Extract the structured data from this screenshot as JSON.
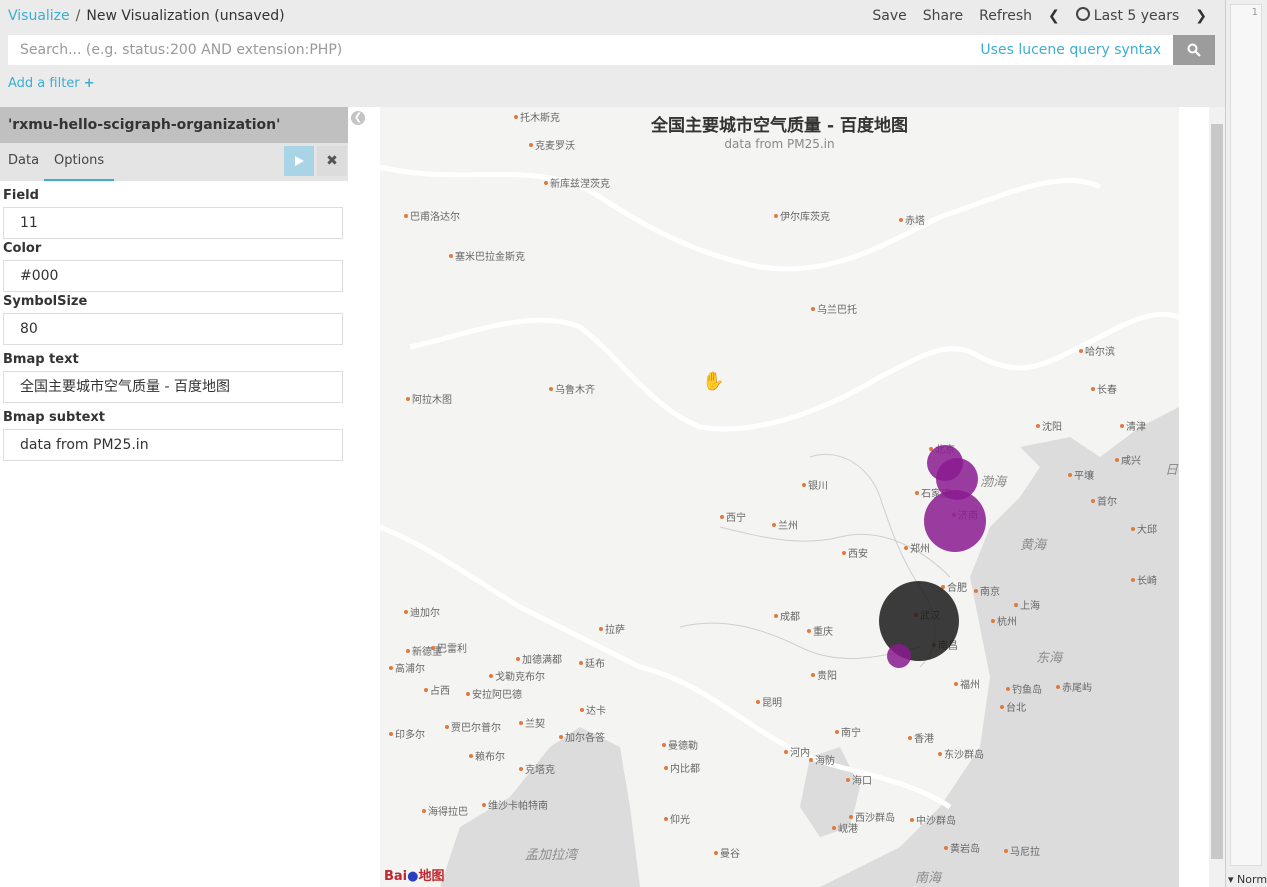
{
  "breadcrumb": {
    "root": "Visualize",
    "separator": "/",
    "current": "New Visualization (unsaved)"
  },
  "menu": {
    "save": "Save",
    "share": "Share",
    "refresh": "Refresh",
    "time_range": "Last 5 years"
  },
  "search": {
    "placeholder": "Search... (e.g. status:200 AND extension:PHP)",
    "syntax_link": "Uses lucene query syntax"
  },
  "filter": {
    "add_label": "Add a filter"
  },
  "sidebar": {
    "index_name": "'rxmu-hello-scigraph-organization'",
    "tabs": [
      {
        "label": "Data"
      },
      {
        "label": "Options"
      }
    ],
    "fields": [
      {
        "label": "Field",
        "value": "11"
      },
      {
        "label": "Color",
        "value": "#000"
      },
      {
        "label": "SymbolSize",
        "value": "80"
      },
      {
        "label": "Bmap text",
        "value": "全国主要城市空气质量 - 百度地图"
      },
      {
        "label": "Bmap subtext",
        "value": "data from PM25.in"
      }
    ]
  },
  "map": {
    "title": "全国主要城市空气质量 - 百度地图",
    "subtitle": "data from PM25.in",
    "logo_text": "地图",
    "cities": [
      {
        "name": "托木斯克"
      },
      {
        "name": "克麦罗沃"
      },
      {
        "name": "新库兹涅茨克"
      },
      {
        "name": "巴甫洛达尔"
      },
      {
        "name": "伊尔库茨克"
      },
      {
        "name": "赤塔"
      },
      {
        "name": "塞米巴拉金斯克"
      },
      {
        "name": "乌兰巴托"
      },
      {
        "name": "哈尔滨"
      },
      {
        "name": "长春"
      },
      {
        "name": "乌鲁木齐"
      },
      {
        "name": "阿拉木图"
      },
      {
        "name": "沈阳"
      },
      {
        "name": "清津"
      },
      {
        "name": "北京"
      },
      {
        "name": "平壤"
      },
      {
        "name": "咸兴"
      },
      {
        "name": "银川"
      },
      {
        "name": "石家庄"
      },
      {
        "name": "济南"
      },
      {
        "name": "首尔"
      },
      {
        "name": "大邱"
      },
      {
        "name": "西宁"
      },
      {
        "name": "兰州"
      },
      {
        "name": "西安"
      },
      {
        "name": "郑州"
      },
      {
        "name": "合肥"
      },
      {
        "name": "南京"
      },
      {
        "name": "上海"
      },
      {
        "name": "杭州"
      },
      {
        "name": "长崎"
      },
      {
        "name": "迪加尔"
      },
      {
        "name": "成都"
      },
      {
        "name": "拉萨"
      },
      {
        "name": "重庆"
      },
      {
        "name": "武汉"
      },
      {
        "name": "南昌"
      },
      {
        "name": "新德里"
      },
      {
        "name": "巴雷利"
      },
      {
        "name": "加德满都"
      },
      {
        "name": "廷布"
      },
      {
        "name": "戈勒克布尔"
      },
      {
        "name": "高浦尔"
      },
      {
        "name": "占西"
      },
      {
        "name": "安拉阿巴德"
      },
      {
        "name": "贵阳"
      },
      {
        "name": "昆明"
      },
      {
        "name": "福州"
      },
      {
        "name": "钓鱼岛"
      },
      {
        "name": "赤尾屿"
      },
      {
        "name": "台北"
      },
      {
        "name": "达卡"
      },
      {
        "name": "印多尔"
      },
      {
        "name": "贾巴尔普尔"
      },
      {
        "name": "兰契"
      },
      {
        "name": "加尔各答"
      },
      {
        "name": "曼德勒"
      },
      {
        "name": "河内"
      },
      {
        "name": "南宁"
      },
      {
        "name": "香港"
      },
      {
        "name": "赖布尔"
      },
      {
        "name": "克塔克"
      },
      {
        "name": "内比都"
      },
      {
        "name": "海防"
      },
      {
        "name": "东沙群岛"
      },
      {
        "name": "海口"
      },
      {
        "name": "海得拉巴"
      },
      {
        "name": "维沙卡帕特南"
      },
      {
        "name": "西沙群岛"
      },
      {
        "name": "中沙群岛"
      },
      {
        "name": "仰光"
      },
      {
        "name": "岘港"
      },
      {
        "name": "黄岩岛"
      },
      {
        "name": "马尼拉"
      },
      {
        "name": "曼谷"
      }
    ],
    "seas": [
      {
        "name": "渤海"
      },
      {
        "name": "黄海"
      },
      {
        "name": "东海"
      },
      {
        "name": "孟加拉湾"
      },
      {
        "name": "南海"
      },
      {
        "name": "日"
      }
    ],
    "bubbles": [
      {
        "label": "北京",
        "size": 36,
        "color": "#8a1b8f"
      },
      {
        "label": "石家庄",
        "size": 42,
        "color": "#8a1b8f"
      },
      {
        "label": "济南",
        "size": 62,
        "color": "#8a1b8f"
      },
      {
        "label": "武汉",
        "size": 80,
        "color": "#1a1a1a"
      },
      {
        "label": "长沙",
        "size": 24,
        "color": "#8a1b8f"
      }
    ]
  },
  "editor": {
    "line_number": "1",
    "mode": "Normal"
  },
  "colors": {
    "accent": "#3caed2",
    "bubble": "#8a1b8f",
    "bubble_dark": "#1a1a1a"
  }
}
